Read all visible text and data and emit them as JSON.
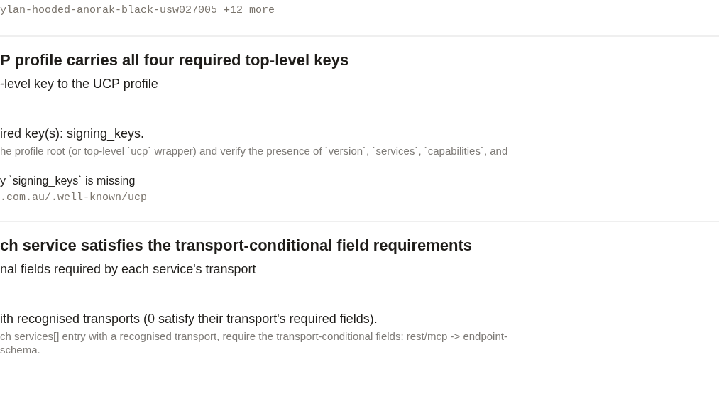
{
  "top_line": "ylan-hooded-anorak-black-usw027005 +12 more",
  "sections": [
    {
      "title": "P profile carries all four required top-level keys",
      "subtitle": "-level key to the UCP profile",
      "lines": [
        {
          "kind": "message",
          "text": "ired key(s): signing_keys."
        },
        {
          "kind": "detail",
          "text": "he profile root (or top-level `ucp` wrapper) and verify the presence of `version`, `services`, `capabilities`, and"
        },
        {
          "kind": "evidence",
          "text": "y `signing_keys` is missing"
        },
        {
          "kind": "url",
          "text": ".com.au/.well-known/ucp"
        }
      ]
    },
    {
      "title": "ch service satisfies the transport-conditional field requirements",
      "subtitle": "nal fields required by each service's transport",
      "lines": [
        {
          "kind": "message",
          "text": "ith recognised transports (0 satisfy their transport's required fields)."
        },
        {
          "kind": "detail",
          "text": "ch services[] entry with a recognised transport, require the transport-conditional fields: rest/mcp -> endpoint-"
        },
        {
          "kind": "detail",
          "text": "schema."
        }
      ]
    }
  ]
}
